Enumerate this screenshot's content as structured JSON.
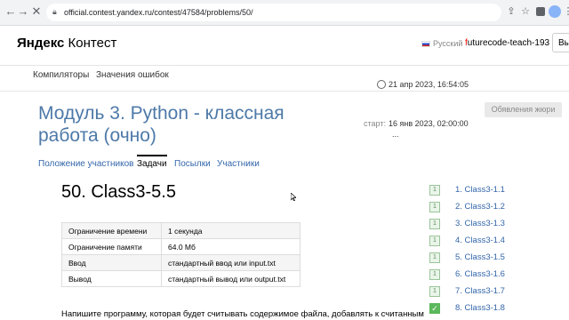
{
  "browser": {
    "url": "official.contest.yandex.ru/contest/47584/problems/50/"
  },
  "header": {
    "logo_brand": "Яндекс",
    "logo_product": "Контест",
    "language": "Русский",
    "user_first": "f",
    "user_rest": "uturecode-teach-193",
    "exit_label": "Вы"
  },
  "topnav": {
    "items": [
      "Компиляторы",
      "Значения ошибок"
    ]
  },
  "contest": {
    "title": "Модуль 3. Python - классная работа (очно)",
    "timer_value": "21 апр 2023, 16:54:05",
    "start_label": "старт:",
    "start_value": "16 янв 2023, 02:00:00",
    "ellipsis": "...",
    "appeal_label": "Обявления жюри"
  },
  "tabs": [
    "Положение участников",
    "Задачи",
    "Посылки",
    "Участники"
  ],
  "problem": {
    "title": "50. Class3-5.5",
    "limits": [
      {
        "key": "Ограничение времени",
        "value": "1 секунда"
      },
      {
        "key": "Ограничение памяти",
        "value": "64.0 Мб"
      },
      {
        "key": "Ввод",
        "value": "стандартный ввод или input.txt"
      },
      {
        "key": "Вывод",
        "value": "стандартный вывод или output.txt"
      }
    ],
    "statement": "Напишите программу, которая будет считывать содержимое файла, добавлять к считанным"
  },
  "problem_list": [
    {
      "badge": "1",
      "name": "1. Class3-1.1",
      "solved": false
    },
    {
      "badge": "1",
      "name": "2. Class3-1.2",
      "solved": false
    },
    {
      "badge": "1",
      "name": "3. Class3-1.3",
      "solved": false
    },
    {
      "badge": "1",
      "name": "4. Class3-1.4",
      "solved": false
    },
    {
      "badge": "1",
      "name": "5. Class3-1.5",
      "solved": false
    },
    {
      "badge": "1",
      "name": "6. Class3-1.6",
      "solved": false
    },
    {
      "badge": "1",
      "name": "7. Class3-1.7",
      "solved": false
    },
    {
      "badge": "✓",
      "name": "8. Class3-1.8",
      "solved": true
    }
  ]
}
